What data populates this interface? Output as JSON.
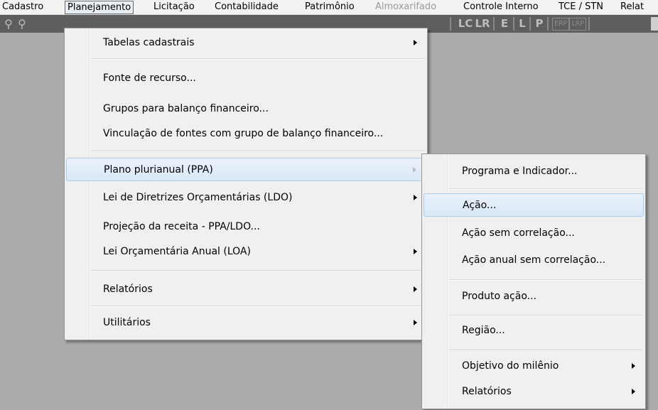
{
  "menubar": {
    "items": [
      {
        "label": "Cadastro"
      },
      {
        "label": "Planejamento"
      },
      {
        "label": "Licitação"
      },
      {
        "label": "Contabilidade"
      },
      {
        "label": "Patrimônio"
      },
      {
        "label": "Almoxarifado"
      },
      {
        "label": "Controle Interno"
      },
      {
        "label": "TCE / STN"
      },
      {
        "label": "Relat"
      }
    ]
  },
  "toolbar": {
    "icons": [
      "key-icon",
      "key-icon",
      "LC",
      "LR",
      "E",
      "L",
      "P",
      "ERP",
      "LRP"
    ]
  },
  "planejamento_menu": {
    "items": [
      {
        "label": "Tabelas cadastrais"
      },
      {
        "label": "Fonte de recurso..."
      },
      {
        "label": "Grupos para balanço financeiro..."
      },
      {
        "label": "Vinculação de fontes com grupo de balanço financeiro..."
      },
      {
        "label": "Plano plurianual (PPA)"
      },
      {
        "label": "Lei de Diretrizes Orçamentárias (LDO)"
      },
      {
        "label": "Projeção da receita - PPA/LDO..."
      },
      {
        "label": "Lei Orçamentária Anual (LOA)"
      },
      {
        "label": "Relatórios"
      },
      {
        "label": "Utilitários"
      }
    ]
  },
  "ppa_submenu": {
    "items": [
      {
        "label": "Programa e Indicador..."
      },
      {
        "label": "Ação..."
      },
      {
        "label": "Ação sem correlação..."
      },
      {
        "label": "Ação anual sem correlação..."
      },
      {
        "label": "Produto ação..."
      },
      {
        "label": "Região..."
      },
      {
        "label": "Objetivo do milênio"
      },
      {
        "label": "Relatórios"
      }
    ]
  },
  "colors": {
    "workspace": "#ababab",
    "toolbar": "#5e5e5e",
    "menu_bg": "#f0f0f0",
    "highlight": "#d9e8f7"
  }
}
